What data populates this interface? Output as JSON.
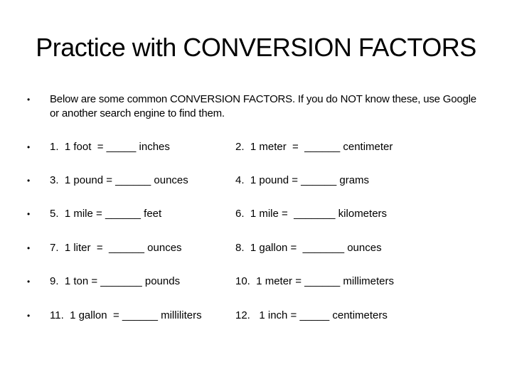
{
  "slide": {
    "title": "Practice with CONVERSION FACTORS",
    "bullet_glyph": "•",
    "intro": "Below are some common CONVERSION FACTORS.  If you do NOT know these, use Google or another search engine to find them.",
    "questions": [
      {
        "left": "1.  1 foot  = _____ inches",
        "right": "2.  1 meter  =  ______ centimeter"
      },
      {
        "left": "3.  1 pound = ______ ounces",
        "right": "4.  1 pound = ______ grams"
      },
      {
        "left": "5.  1 mile = ______ feet",
        "right": "6.  1 mile =  _______ kilometers"
      },
      {
        "left": "7.  1 liter  =  ______ ounces",
        "right": "8.  1 gallon =  _______ ounces"
      },
      {
        "left": "9.  1 ton = _______ pounds",
        "right": "10.  1 meter = ______ millimeters"
      },
      {
        "left": "11.  1 gallon  = ______ milliliters",
        "right": "12.   1 inch = _____ centimeters"
      }
    ]
  }
}
